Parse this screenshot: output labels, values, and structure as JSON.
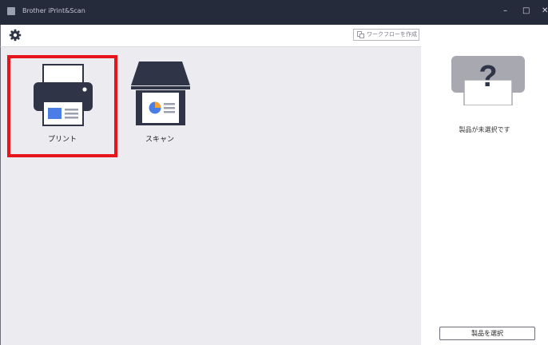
{
  "window": {
    "title": "Brother iPrint&Scan",
    "minimize": "–",
    "maximize": "□",
    "close": "✕"
  },
  "toolbar": {
    "settings_icon": "gear-icon",
    "create_workflow_label": "ワークフローを作成"
  },
  "main": {
    "tiles": [
      {
        "label": "プリント",
        "icon": "printer-icon",
        "selected": true
      },
      {
        "label": "スキャン",
        "icon": "scanner-icon",
        "selected": false
      }
    ]
  },
  "side": {
    "status_text": "製品が未選択です",
    "select_button_label": "製品を選択",
    "device_icon": "question-printer-icon"
  },
  "colors": {
    "titlebar": "#262b3c",
    "highlight": "#e8141c",
    "pane": "#ecebf0",
    "icon_dark": "#2f3547"
  }
}
